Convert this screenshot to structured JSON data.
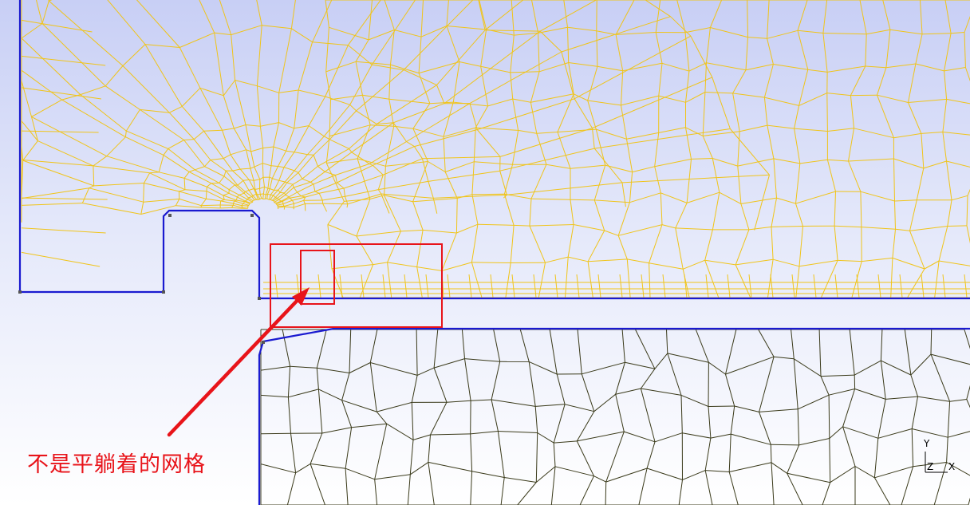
{
  "viewport": {
    "background_top": "#c8cff5",
    "background_bottom": "#ffffff",
    "upper_mesh_color": "#f0c419",
    "lower_mesh_color": "#3a3a1a",
    "boundary_color": "#1a1ad0",
    "highlight_color": "#e8141a"
  },
  "annotation": {
    "text": "不是平躺着的网格"
  },
  "axis_triad": {
    "y_label": "Y",
    "z_label": "Z",
    "x_label": "X"
  }
}
